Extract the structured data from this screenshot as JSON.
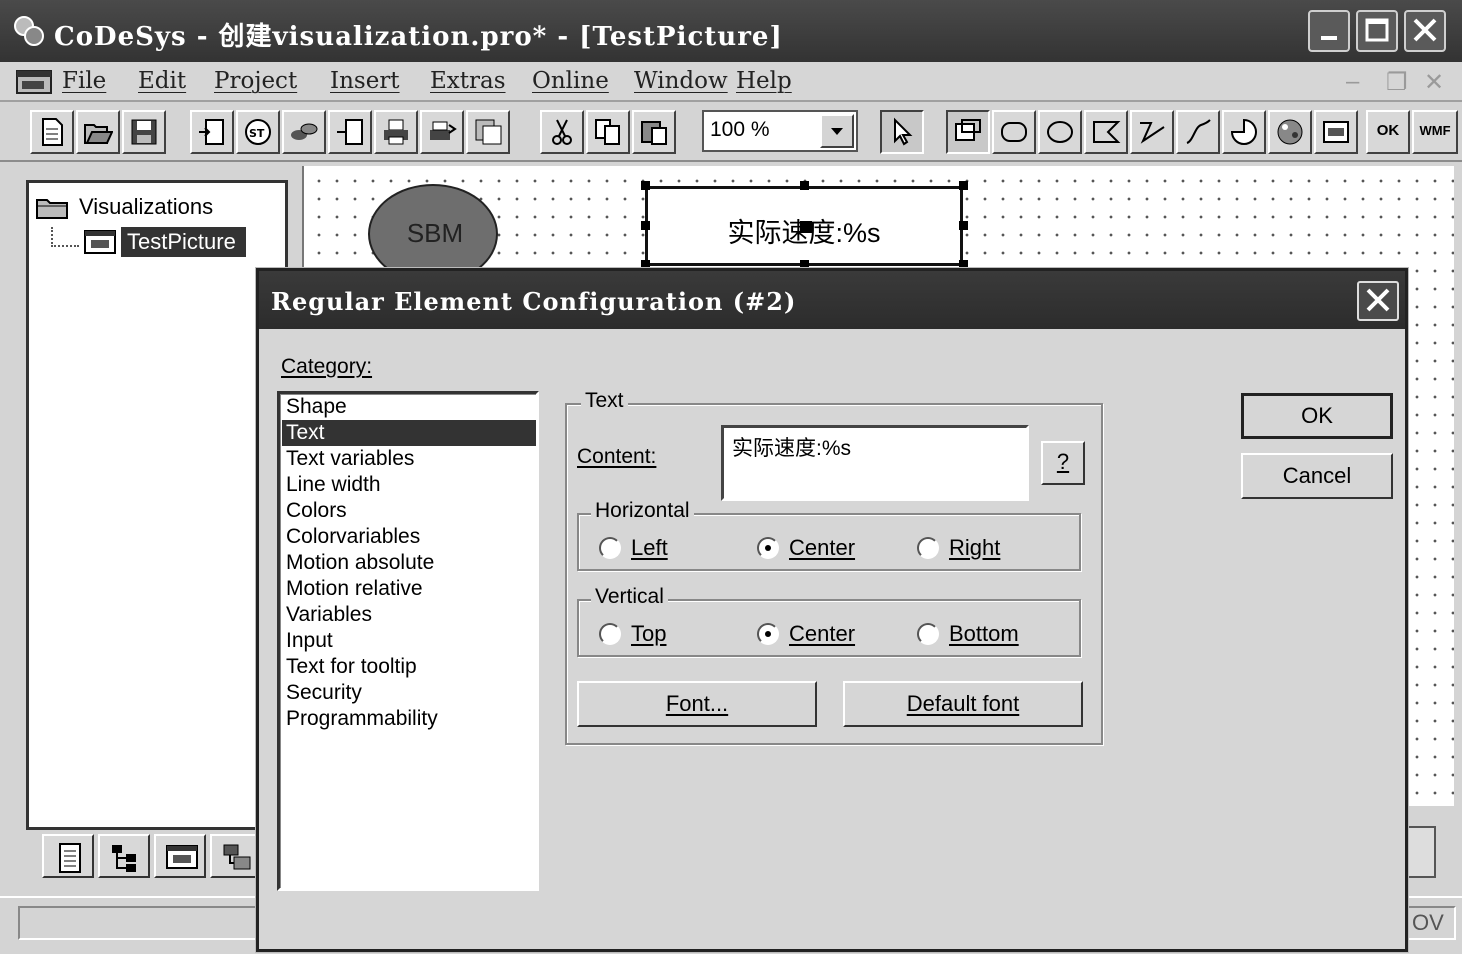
{
  "window": {
    "title": "CoDeSys - 创建visualization.pro* - [TestPicture]"
  },
  "menu": {
    "items": [
      "File",
      "Edit",
      "Project",
      "Insert",
      "Extras",
      "Online",
      "Window",
      "Help"
    ]
  },
  "toolbar": {
    "zoom_value": "100 %",
    "ok_icon_label": "OK",
    "wmf_icon_label": "WMF"
  },
  "organizer": {
    "root_label": "Visualizations",
    "child_label": "TestPicture"
  },
  "canvas": {
    "ellipse_label": "SBM",
    "textbox_content": "实际速度:%s"
  },
  "statusbar": {
    "mode": "OV"
  },
  "dialog": {
    "title": "Regular Element Configuration (#2)",
    "category_label": "Category:",
    "categories": [
      "Shape",
      "Text",
      "Text variables",
      "Line width",
      "Colors",
      "Colorvariables",
      "Motion absolute",
      "Motion relative",
      "Variables",
      "Input",
      "Text for tooltip",
      "Security",
      "Programmability"
    ],
    "selected_category": "Text",
    "text_group": {
      "label": "Text",
      "content_label": "Content:",
      "content_value": "实际速度:%s",
      "help_button": "?",
      "horizontal": {
        "label": "Horizontal",
        "options": [
          "Left",
          "Center",
          "Right"
        ],
        "selected": "Center"
      },
      "vertical": {
        "label": "Vertical",
        "options": [
          "Top",
          "Center",
          "Bottom"
        ],
        "selected": "Center"
      },
      "font_button": "Font...",
      "default_font_button": "Default font"
    },
    "ok_button": "OK",
    "cancel_button": "Cancel"
  }
}
